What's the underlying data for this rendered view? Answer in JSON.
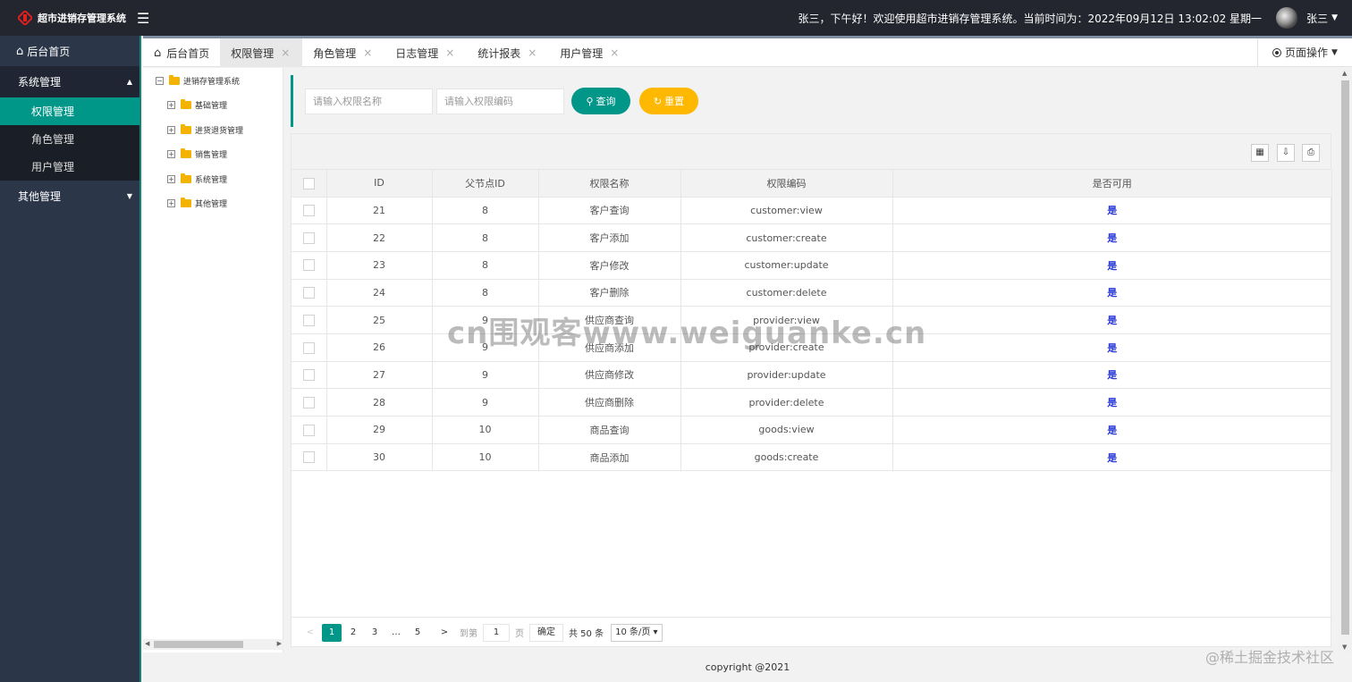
{
  "app": {
    "title": "超市进销存管理系统",
    "greeting": "张三，下午好！欢迎使用超市进销存管理系统。当前时间为：2022年09月12日 13:02:02 星期一",
    "user": "张三"
  },
  "sidebar": {
    "home": "后台首页",
    "groups": [
      {
        "label": "系统管理",
        "items": [
          "权限管理",
          "角色管理",
          "用户管理"
        ]
      },
      {
        "label": "其他管理"
      }
    ]
  },
  "tabs": {
    "home": "后台首页",
    "items": [
      {
        "label": "权限管理",
        "active": true
      },
      {
        "label": "角色管理"
      },
      {
        "label": "日志管理"
      },
      {
        "label": "统计报表"
      },
      {
        "label": "用户管理"
      }
    ],
    "close_icon": "×",
    "page_ops": "页面操作"
  },
  "tree": {
    "root": "进销存管理系统",
    "children": [
      "基础管理",
      "进货退货管理",
      "销售管理",
      "系统管理",
      "其他管理"
    ]
  },
  "search": {
    "name_placeholder": "请输入权限名称",
    "code_placeholder": "请输入权限编码",
    "query_label": "查询",
    "reset_label": "重置"
  },
  "table": {
    "headers": [
      "ID",
      "父节点ID",
      "权限名称",
      "权限编码",
      "是否可用"
    ],
    "rows": [
      [
        "21",
        "8",
        "客户查询",
        "customer:view",
        "是"
      ],
      [
        "22",
        "8",
        "客户添加",
        "customer:create",
        "是"
      ],
      [
        "23",
        "8",
        "客户修改",
        "customer:update",
        "是"
      ],
      [
        "24",
        "8",
        "客户删除",
        "customer:delete",
        "是"
      ],
      [
        "25",
        "9",
        "供应商查询",
        "provider:view",
        "是"
      ],
      [
        "26",
        "9",
        "供应商添加",
        "provider:create",
        "是"
      ],
      [
        "27",
        "9",
        "供应商修改",
        "provider:update",
        "是"
      ],
      [
        "28",
        "9",
        "供应商删除",
        "provider:delete",
        "是"
      ],
      [
        "29",
        "10",
        "商品查询",
        "goods:view",
        "是"
      ],
      [
        "30",
        "10",
        "商品添加",
        "goods:create",
        "是"
      ]
    ]
  },
  "pager": {
    "pages": [
      "1",
      "2",
      "3",
      "…",
      "5"
    ],
    "goto_label": "到第",
    "goto_value": "1",
    "page_unit": "页",
    "confirm": "确定",
    "total": "共 50 条",
    "per_page": "10 条/页"
  },
  "footer": "copyright @2021",
  "watermarks": {
    "center": "cn围观客www.weiguanke.cn",
    "corner": "@稀土掘金技术社区"
  },
  "colors": {
    "topbar": "#23262e",
    "sidebar": "#2b3649",
    "accent": "#009688",
    "reset": "#ffb800",
    "yes_text": "#2838d6"
  }
}
